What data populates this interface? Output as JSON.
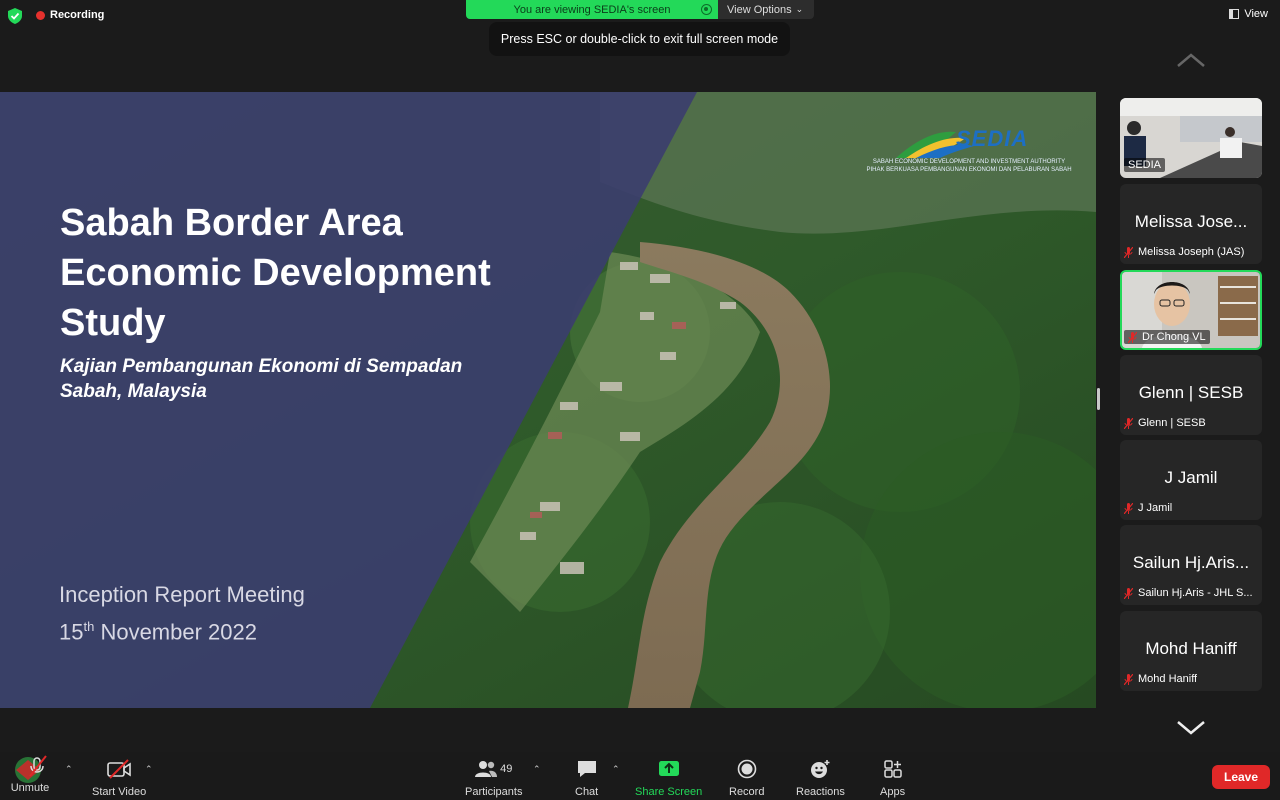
{
  "topbar": {
    "recording_label": "Recording",
    "viewing_banner": "You are viewing SEDIA's screen",
    "view_options_label": "View Options",
    "esc_tip": "Press ESC or double-click to exit full screen mode",
    "view_label": "View"
  },
  "slide": {
    "title": "Sabah Border Area\nEconomic Development\nStudy",
    "subtitle": "Kajian Pembangunan Ekonomi di Sempadan\nSabah, Malaysia",
    "meeting": "Inception Report Meeting",
    "date_day": "15",
    "date_suffix": "th",
    "date_rest": " November 2022",
    "logo_text": "SEDIA",
    "logo_small_1": "SABAH ECONOMIC DEVELOPMENT AND INVESTMENT AUTHORITY",
    "logo_small_2": "PIHAK BERKUASA PEMBANGUNAN EKONOMI DAN PELABURAN SABAH"
  },
  "participants_panel": [
    {
      "name": "",
      "label": "SEDIA",
      "muted": false,
      "video": true,
      "active": false
    },
    {
      "name": "Melissa Jose...",
      "label": "Melissa Joseph (JAS)",
      "muted": true,
      "video": false,
      "active": false
    },
    {
      "name": "",
      "label": "Dr Chong VL",
      "muted": true,
      "video": true,
      "active": true
    },
    {
      "name": "Glenn | SESB",
      "label": "Glenn | SESB",
      "muted": true,
      "video": false,
      "active": false
    },
    {
      "name": "J Jamil",
      "label": "J Jamil",
      "muted": true,
      "video": false,
      "active": false
    },
    {
      "name": "Sailun Hj.Aris...",
      "label": "Sailun Hj.Aris - JHL S...",
      "muted": true,
      "video": false,
      "active": false
    },
    {
      "name": "Mohd Haniff",
      "label": "Mohd Haniff",
      "muted": true,
      "video": false,
      "active": false
    }
  ],
  "toolbar": {
    "unmute": "Unmute",
    "start_video": "Start Video",
    "participants": "Participants",
    "participants_count": "49",
    "chat": "Chat",
    "share_screen": "Share Screen",
    "record": "Record",
    "reactions": "Reactions",
    "apps": "Apps",
    "leave": "Leave"
  },
  "colors": {
    "share_green": "#23d959",
    "leave_red": "#e02828",
    "slide_overlay": "#3b3d6e"
  }
}
